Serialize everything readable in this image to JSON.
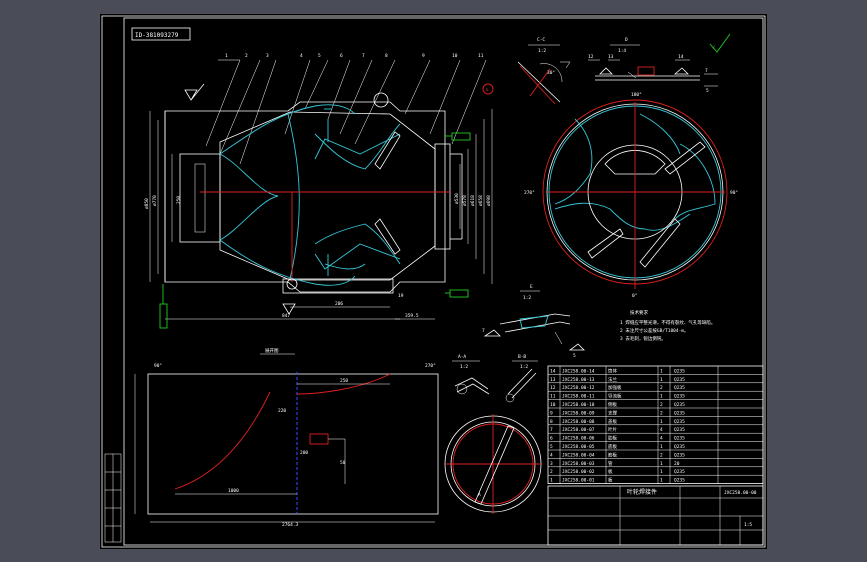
{
  "drawing": {
    "id_label": "ID-381093279",
    "part_numbers": [
      "1",
      "2",
      "3",
      "4",
      "5",
      "6",
      "7",
      "8",
      "9",
      "10",
      "11"
    ],
    "view_cc": {
      "label": "C-C",
      "scale": "1:2"
    },
    "view_d": {
      "label": "D",
      "scale": "1:4"
    },
    "detail_numbers": [
      "12",
      "13",
      "14"
    ],
    "view_e": {
      "label": "E",
      "scale": "1:2"
    },
    "view_aa": {
      "label": "A-A",
      "scale": "1:2"
    },
    "view_bb": {
      "label": "B-B",
      "scale": "1:2"
    },
    "angles": {
      "top": "180°",
      "bottom": "0°",
      "left": "270°",
      "right": "90°"
    },
    "unfold_title": "展开图",
    "unfold_angles": {
      "left": "90°",
      "right": "270°"
    },
    "dims": {
      "d1": "250",
      "d2": "220",
      "d3": "200",
      "d4": "1000",
      "d5": "50",
      "d6": "206",
      "d7": "847",
      "d8": "359.5",
      "d9": "19"
    },
    "notes_title": "技术要求",
    "notes": [
      "1 焊缝应平整光滑，不得有裂纹、气孔等缺陷。",
      "2 未注尺寸公差按GB/T1804-m。",
      "3 去毛刺，锐边倒钝。"
    ],
    "bom_rows": [
      [
        "14",
        "JXC258.00-14",
        "筒体",
        "1",
        "Q235"
      ],
      [
        "13",
        "JXC258.00-13",
        "法兰",
        "1",
        "Q235"
      ],
      [
        "12",
        "JXC258.00-12",
        "加强板",
        "2",
        "Q235"
      ],
      [
        "11",
        "JXC258.00-11",
        "导流板",
        "1",
        "Q235"
      ],
      [
        "10",
        "JXC258.00-10",
        "侧板",
        "2",
        "Q235"
      ],
      [
        "9",
        "JXC258.00-09",
        "支撑",
        "2",
        "Q235"
      ],
      [
        "8",
        "JXC258.00-08",
        "盖板",
        "1",
        "Q235"
      ],
      [
        "7",
        "JXC258.00-07",
        "叶片",
        "4",
        "Q235"
      ],
      [
        "6",
        "JXC258.00-06",
        "肋板",
        "4",
        "Q235"
      ],
      [
        "5",
        "JXC258.00-05",
        "底板",
        "1",
        "Q235"
      ],
      [
        "4",
        "JXC258.00-04",
        "筋板",
        "2",
        "Q235"
      ],
      [
        "3",
        "JXC258.00-03",
        "管",
        "1",
        "20"
      ],
      [
        "2",
        "JXC258.00-02",
        "板",
        "1",
        "Q235"
      ],
      [
        "1",
        "JXC258.00-01",
        "板",
        "1",
        "Q235"
      ]
    ],
    "title_block": {
      "name": "叶轮焊接件",
      "code": "JXC258.00-00",
      "scale": "1:5"
    }
  },
  "colors": {
    "background": "#000000",
    "frame": "#ffffff",
    "cyan": "#35c8d8",
    "red": "#e02020",
    "green": "#22cc22",
    "blue": "#3050ff"
  }
}
